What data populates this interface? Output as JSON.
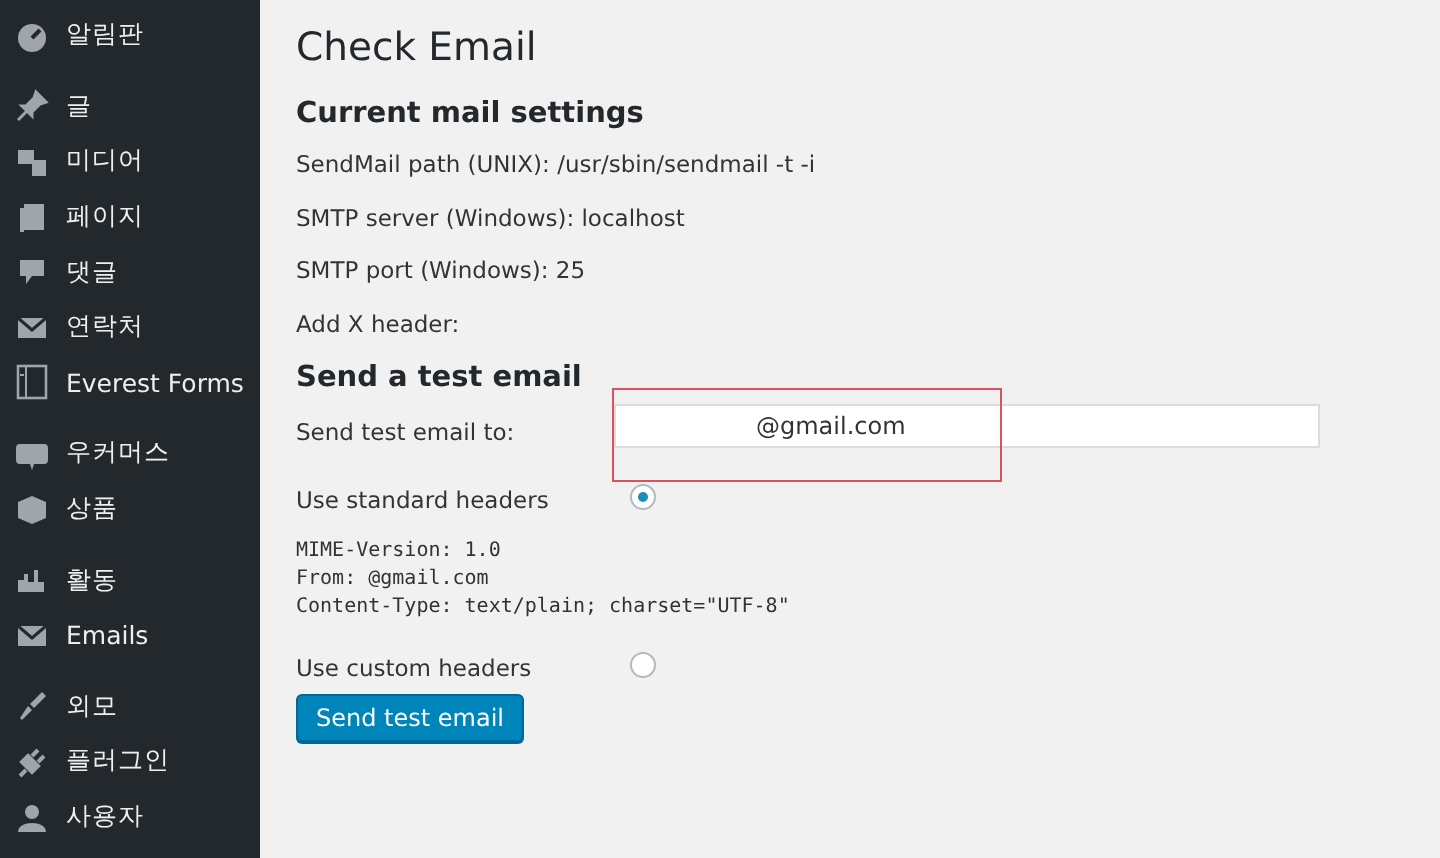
{
  "sidebar": {
    "groups": [
      {
        "items": [
          {
            "label": "알림판"
          }
        ]
      },
      {
        "items": [
          {
            "label": "글"
          },
          {
            "label": "미디어"
          },
          {
            "label": "페이지"
          },
          {
            "label": "댓글"
          },
          {
            "label": "연락처"
          },
          {
            "label": "Everest Forms"
          }
        ]
      },
      {
        "items": [
          {
            "label": "우커머스"
          },
          {
            "label": "상품"
          }
        ]
      },
      {
        "items": [
          {
            "label": "활동"
          },
          {
            "label": "Emails"
          }
        ]
      },
      {
        "items": [
          {
            "label": "외모"
          },
          {
            "label": "플러그인"
          },
          {
            "label": "사용자"
          }
        ]
      }
    ]
  },
  "page": {
    "title": "Check Email",
    "current_settings": {
      "heading": "Current mail settings",
      "lines": [
        "SendMail path (UNIX): /usr/sbin/sendmail -t -i",
        "SMTP server (Windows): localhost",
        "SMTP port (Windows): 25",
        "Add X header:"
      ]
    },
    "test_email": {
      "heading": "Send a test email",
      "to_label": "Send test email to:",
      "to_value": "@gmail.com",
      "highlighted": true,
      "header_options": [
        {
          "label": "Use standard headers",
          "selected": true,
          "headers": [
            "MIME-Version: 1.0",
            "From: @gmail.com",
            "Content-Type: text/plain; charset=\"UTF-8\""
          ]
        },
        {
          "label": "Use custom headers",
          "selected": false
        }
      ],
      "submit": "Send test email"
    }
  }
}
